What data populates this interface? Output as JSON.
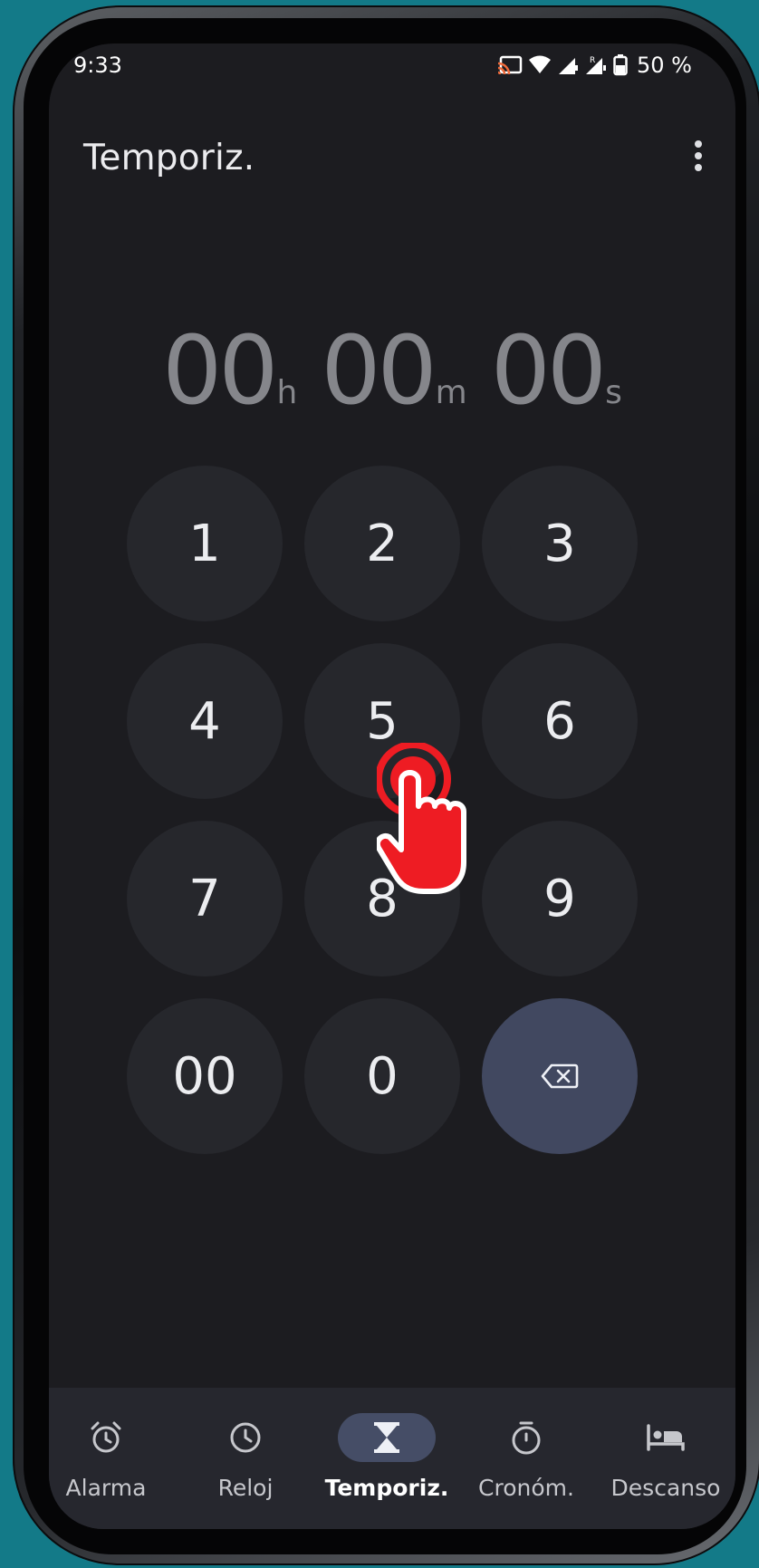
{
  "status_bar": {
    "time": "9:33",
    "battery": "50 %",
    "icons": [
      "cast-icon",
      "wifi-icon",
      "signal-icon",
      "signal-roaming-icon",
      "battery-icon"
    ]
  },
  "app": {
    "title": "Temporiz.",
    "menu_icon": "more-vert-icon"
  },
  "timer_display": {
    "hours": "00",
    "hours_unit": "h",
    "minutes": "00",
    "minutes_unit": "m",
    "seconds": "00",
    "seconds_unit": "s"
  },
  "keypad": {
    "keys": [
      "1",
      "2",
      "3",
      "4",
      "5",
      "6",
      "7",
      "8",
      "9",
      "00",
      "0"
    ],
    "backspace_icon": "backspace-icon"
  },
  "nav": {
    "items": [
      {
        "label": "Alarma",
        "icon": "alarm-icon"
      },
      {
        "label": "Reloj",
        "icon": "clock-icon"
      },
      {
        "label": "Temporiz.",
        "icon": "hourglass-icon",
        "active": true
      },
      {
        "label": "Cronóm.",
        "icon": "stopwatch-icon"
      },
      {
        "label": "Descanso",
        "icon": "bed-icon"
      }
    ]
  },
  "colors": {
    "background": "#1c1c20",
    "key": "#26272c",
    "backspace_key": "#414860",
    "active_pill": "#454d66",
    "tap_indicator": "#ee1c23"
  }
}
